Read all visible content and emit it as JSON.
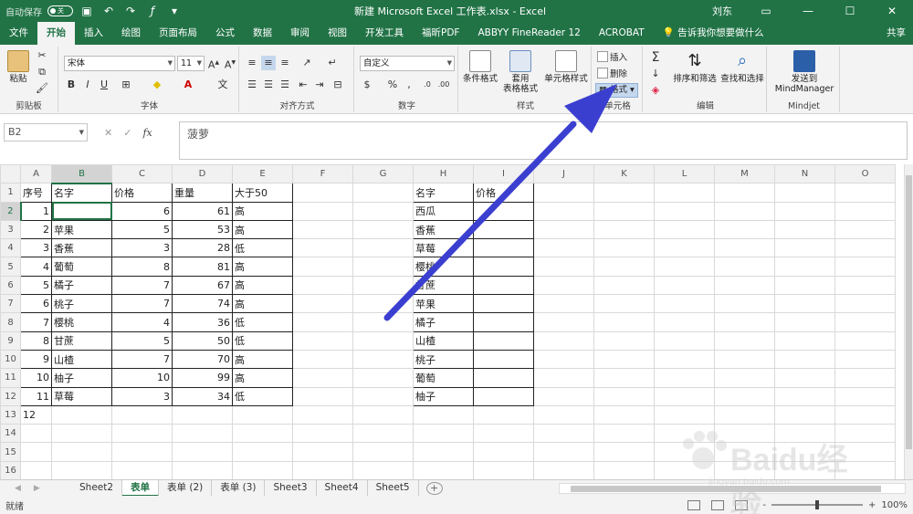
{
  "titlebar": {
    "autosave": "自动保存",
    "toggle_state": "关",
    "title": "新建 Microsoft Excel 工作表.xlsx  -  Excel",
    "user": "刘东"
  },
  "tabs": [
    "文件",
    "开始",
    "插入",
    "绘图",
    "页面布局",
    "公式",
    "数据",
    "审阅",
    "视图",
    "开发工具",
    "福昕PDF",
    "ABBYY FineReader 12",
    "ACROBAT"
  ],
  "active_tab": "开始",
  "tell_me": "告诉我你想要做什么",
  "share": "共享",
  "ribbon": {
    "clipboard": {
      "paste": "粘贴",
      "label": "剪贴板"
    },
    "font": {
      "name": "宋体",
      "size": "11",
      "label": "字体",
      "bold": "B",
      "italic": "I",
      "underline": "U"
    },
    "alignment": {
      "label": "对齐方式"
    },
    "number": {
      "format": "自定义",
      "label": "数字",
      "percent": "%",
      "comma": ","
    },
    "styles": {
      "conditional": "条件格式",
      "table_format_1": "套用",
      "table_format_2": "表格格式",
      "cell_style": "单元格样式",
      "label": "样式"
    },
    "cells": {
      "insert": "插入",
      "delete": "删除",
      "format": "格式",
      "label": "单元格"
    },
    "editing": {
      "sort_filter": "排序和筛选",
      "find_select": "查找和选择",
      "label": "编辑"
    },
    "mindjet": {
      "send_1": "发送到",
      "send_2": "MindManager",
      "label": "Mindjet"
    }
  },
  "formula_bar": {
    "name_box": "B2",
    "fx": "fx",
    "content": "菠萝"
  },
  "columns": [
    "A",
    "B",
    "C",
    "D",
    "E",
    "F",
    "G",
    "H",
    "I",
    "J",
    "K",
    "L",
    "M",
    "N",
    "O"
  ],
  "rows": [
    [
      "1",
      "序号",
      "名字",
      "价格",
      "重量",
      "大于50",
      "",
      "",
      "名字",
      "价格"
    ],
    [
      "2",
      "1",
      "",
      "6",
      "61",
      "高",
      "",
      "",
      "西瓜",
      ""
    ],
    [
      "3",
      "2",
      "苹果",
      "5",
      "53",
      "高",
      "",
      "",
      "香蕉",
      ""
    ],
    [
      "4",
      "3",
      "香蕉",
      "3",
      "28",
      "低",
      "",
      "",
      "草莓",
      ""
    ],
    [
      "5",
      "4",
      "葡萄",
      "8",
      "81",
      "高",
      "",
      "",
      "樱桃",
      ""
    ],
    [
      "6",
      "5",
      "橘子",
      "7",
      "67",
      "高",
      "",
      "",
      "甘蔗",
      ""
    ],
    [
      "7",
      "6",
      "桃子",
      "7",
      "74",
      "高",
      "",
      "",
      "苹果",
      ""
    ],
    [
      "8",
      "7",
      "樱桃",
      "4",
      "36",
      "低",
      "",
      "",
      "橘子",
      ""
    ],
    [
      "9",
      "8",
      "甘蔗",
      "5",
      "50",
      "低",
      "",
      "",
      "山楂",
      ""
    ],
    [
      "10",
      "9",
      "山楂",
      "7",
      "70",
      "高",
      "",
      "",
      "桃子",
      ""
    ],
    [
      "11",
      "10",
      "柚子",
      "10",
      "99",
      "高",
      "",
      "",
      "葡萄",
      ""
    ],
    [
      "12",
      "11",
      "草莓",
      "3",
      "34",
      "低",
      "",
      "",
      "柚子",
      ""
    ],
    [
      "13",
      "12",
      "",
      "",
      "",
      "",
      "",
      "",
      "",
      ""
    ],
    [
      "14",
      "",
      "",
      "",
      "",
      "",
      "",
      "",
      "",
      ""
    ],
    [
      "15",
      "",
      "",
      "",
      "",
      "",
      "",
      "",
      "",
      ""
    ],
    [
      "16",
      "",
      "",
      "",
      "",
      "",
      "",
      "",
      "",
      ""
    ],
    [
      "17",
      "",
      "",
      "",
      "",
      "",
      "",
      "",
      "",
      ""
    ]
  ],
  "sheets": [
    "Sheet2",
    "表单",
    "表单 (2)",
    "表单 (3)",
    "Sheet3",
    "Sheet4",
    "Sheet5"
  ],
  "active_sheet": "表单",
  "status": {
    "ready": "就绪",
    "zoom": "100%",
    "minus": "-",
    "plus": "+"
  },
  "watermark": {
    "brand": "Baidu经验",
    "url": "jingyan.baidu.com"
  },
  "colors": {
    "excel_green": "#217346",
    "arrow_blue": "#3b3fd0"
  }
}
